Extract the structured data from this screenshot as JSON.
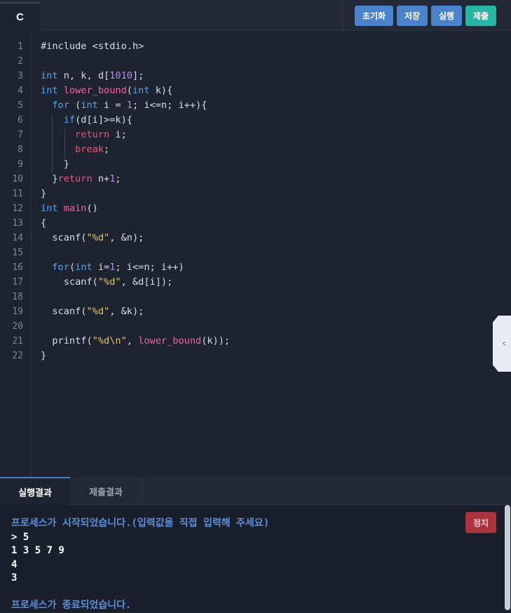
{
  "editor": {
    "language_tab": "C",
    "buttons": {
      "reset": "초기화",
      "save": "저장",
      "run": "실행",
      "submit": "제출"
    },
    "line_numbers": [
      "1",
      "2",
      "3",
      "4",
      "5",
      "6",
      "7",
      "8",
      "9",
      "10",
      "11",
      "12",
      "13",
      "14",
      "15",
      "16",
      "17",
      "18",
      "19",
      "20",
      "21",
      "22"
    ]
  },
  "code": [
    "#include <stdio.h>",
    "",
    "int n, k, d[1010];",
    "int lower_bound(int k){",
    "  for (int i = 1; i<=n; i++){",
    "    if(d[i]>=k){",
    "      return i;",
    "      break;",
    "    }",
    "  }return n+1;",
    "}",
    "int main()",
    "{",
    "  scanf(\"%d\", &n);",
    "",
    "  for(int i=1; i<=n; i++)",
    "    scanf(\"%d\", &d[i]);",
    "",
    "  scanf(\"%d\", &k);",
    "",
    "  printf(\"%d\\n\", lower_bound(k));",
    "}"
  ],
  "bottom_tabs": {
    "run_result": "실행결과",
    "submit_result": "제출결과"
  },
  "console": {
    "stop_button": "정지",
    "lines": [
      "프로세스가 시작되었습니다.(입력값을 직접 입력해 주세요)",
      "> 5",
      "1 3 5 7 9",
      "4",
      "3",
      "",
      "프로세스가 종료되었습니다."
    ]
  },
  "side_handle_icon": "chevron-left-icon",
  "colors": {
    "background": "#1e2330",
    "button_blue": "#4a83c9",
    "button_submit": "#29b3a3",
    "stop_button": "#a9343f",
    "system_message": "#5a8fd8"
  }
}
